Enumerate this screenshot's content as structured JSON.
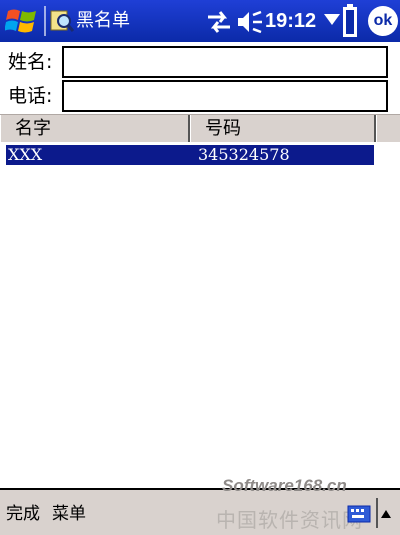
{
  "titlebar": {
    "title": "黑名单",
    "time": "19:12",
    "ok_label": "ok",
    "colors": {
      "bar": "#0b2aa8"
    }
  },
  "form": {
    "name_label": "姓名:",
    "name_value": "",
    "phone_label": "电话:",
    "phone_value": ""
  },
  "list": {
    "columns": [
      "名字",
      "号码"
    ],
    "rows": [
      {
        "name": "XXX",
        "number": "345324578",
        "selected": true
      }
    ],
    "selection_color": "#0c1a8c"
  },
  "menubar": {
    "left_softkey": "完成",
    "right_softkey": "菜单",
    "watermark": "中国软件资讯网",
    "watermark_top": "Software168.cn"
  },
  "icons": {
    "start": "windows-flag-icon",
    "app": "blacklist-app-icon",
    "connectivity": "connectivity-icon",
    "volume": "speaker-icon",
    "battery": "battery-icon",
    "sip": "keyboard-icon"
  }
}
